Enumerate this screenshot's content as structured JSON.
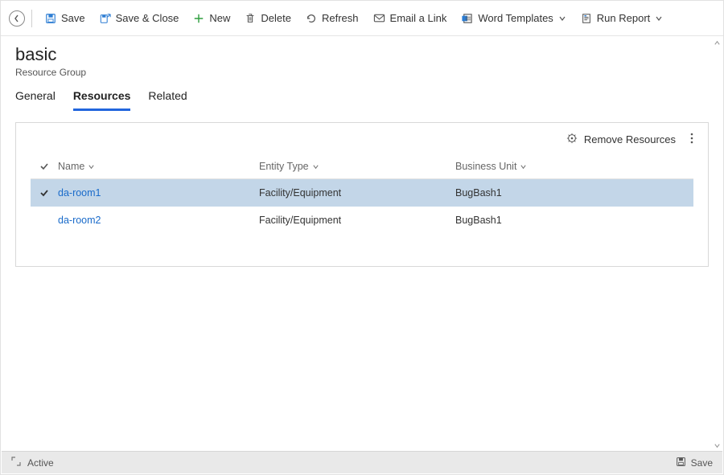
{
  "commandbar": {
    "save": "Save",
    "saveclose": "Save & Close",
    "new": "New",
    "delete": "Delete",
    "refresh": "Refresh",
    "emaillink": "Email a Link",
    "wordtemplates": "Word Templates",
    "runreport": "Run Report"
  },
  "record": {
    "title": "basic",
    "subtitle": "Resource Group"
  },
  "tabs": {
    "general": "General",
    "resources": "Resources",
    "related": "Related"
  },
  "panel": {
    "removeresources": "Remove Resources"
  },
  "grid": {
    "headers": {
      "name": "Name",
      "entitytype": "Entity Type",
      "businessunit": "Business Unit"
    },
    "rows": [
      {
        "name": "da-room1",
        "entitytype": "Facility/Equipment",
        "businessunit": "BugBash1",
        "selected": true
      },
      {
        "name": "da-room2",
        "entitytype": "Facility/Equipment",
        "businessunit": "BugBash1",
        "selected": false
      }
    ]
  },
  "statusbar": {
    "status": "Active",
    "save": "Save"
  }
}
